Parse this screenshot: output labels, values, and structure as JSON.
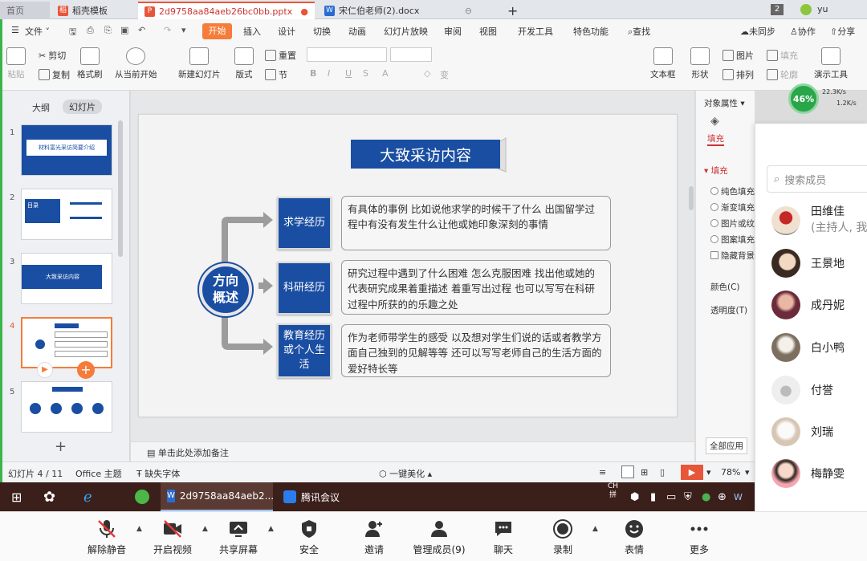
{
  "tabs": {
    "home": "首页",
    "template": "稻壳模板",
    "pptx": "2d9758aa84aeb26bc0bb.pptx",
    "docx": "宋仁伯老师(2).docx",
    "add": "+",
    "badge": "2",
    "user": "yu"
  },
  "menu": {
    "file": "文件",
    "items": [
      "开始",
      "插入",
      "设计",
      "切换",
      "动画",
      "幻灯片放映",
      "审阅",
      "视图",
      "开发工具",
      "特色功能",
      "查找"
    ],
    "unsynced": "未同步",
    "collab": "协作",
    "share": "分享"
  },
  "ribbon": {
    "paste": "粘贴",
    "cut": "剪切",
    "copy": "复制",
    "format_painter": "格式刷",
    "play_from_current": "从当前开始",
    "new_slide": "新建幻灯片",
    "layout": "版式",
    "section": "节",
    "reset": "重置",
    "textbox": "文本框",
    "shapes": "形状",
    "picture": "图片",
    "arrange": "排列",
    "fill": "填充",
    "outline": "轮廓",
    "presenter_tools": "演示工具"
  },
  "left_pane": {
    "outline_tab": "大纲",
    "slides_tab": "幻灯片",
    "add_slide": "+",
    "thumbs": [
      {
        "num": "1",
        "text": "材料富光采访简要介绍"
      },
      {
        "num": "2",
        "text": "目录"
      },
      {
        "num": "3",
        "text": "大致采访内容"
      },
      {
        "num": "4",
        "text": ""
      },
      {
        "num": "5",
        "text": ""
      }
    ]
  },
  "slide": {
    "title": "大致采访内容",
    "center": "方向\n概述",
    "rows": [
      {
        "label": "求学经历",
        "desc": "有具体的事例 比如说他求学的时候干了什么 出国留学过程中有没有发生什么让他或她印象深刻的事情"
      },
      {
        "label": "科研经历",
        "desc": "研究过程中遇到了什么困难 怎么克服困难 找出他或她的代表研究成果着重描述 着重写出过程 也可以写写在科研过程中所获的的乐趣之处"
      },
      {
        "label": "教育经历或个人生活",
        "desc": "作为老师带学生的感受 以及想对学生们说的话或者教学方面自己独到的见解等等 还可以写写老师自己的生活方面的爱好特长等"
      }
    ]
  },
  "notes": "单击此处添加备注",
  "status": {
    "slide_count": "幻灯片 4 / 11",
    "theme": "Office 主题",
    "missing_font": "缺失字体",
    "beautify": "一键美化",
    "zoom": "78%"
  },
  "props": {
    "title": "对象属性",
    "fill_tab": "填充",
    "fill_section": "填充",
    "options": [
      "纯色填充",
      "渐变填充",
      "图片或纹",
      "图案填充"
    ],
    "hide_bg": "隐藏背景",
    "color": "颜色(C)",
    "transparency": "透明度(T)",
    "apply_all": "全部应用"
  },
  "net": {
    "percent": "46%",
    "up": "22.3K/s",
    "down": "1.2K/s"
  },
  "taskbar": {
    "pptx": "2d9758aa84aeb2...",
    "meeting": "腾讯会议",
    "ime": "CH",
    "ime2": "拼"
  },
  "meeting": {
    "unmute": "解除静音",
    "start_video": "开启视频",
    "share_screen": "共享屏幕",
    "security": "安全",
    "invite": "邀请",
    "manage": "管理成员(9)",
    "chat": "聊天",
    "record": "录制",
    "reactions": "表情",
    "more": "更多"
  },
  "members": {
    "search_placeholder": "搜索成员",
    "list": [
      {
        "name": "田维佳",
        "role": "(主持人, 我)"
      },
      {
        "name": "王景地",
        "role": ""
      },
      {
        "name": "成丹妮",
        "role": ""
      },
      {
        "name": "白小鸭",
        "role": ""
      },
      {
        "name": "付誉",
        "role": ""
      },
      {
        "name": "刘瑞",
        "role": ""
      },
      {
        "name": "梅静雯",
        "role": ""
      }
    ]
  },
  "colors": {
    "accent": "#f57c3a",
    "slide_blue": "#1a4ea2",
    "taskbar": "#3b1f1a"
  }
}
